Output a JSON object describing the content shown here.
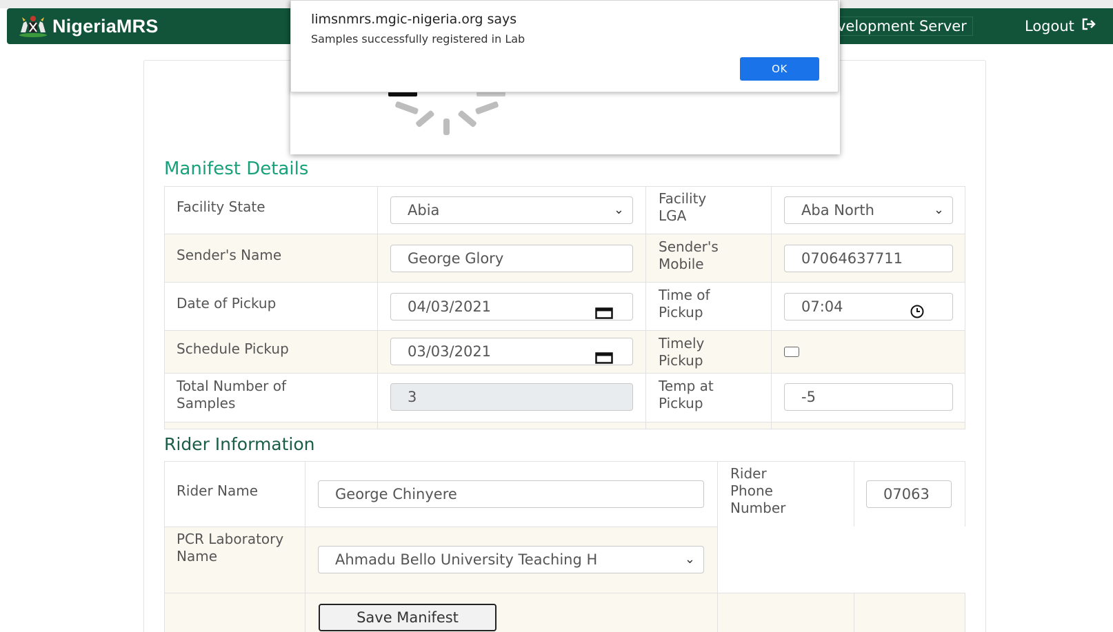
{
  "navbar": {
    "brand": "NigeriaMRS",
    "server_label": "velopment Server",
    "logout_label": "Logout",
    "logout_icon": "sign-out-icon",
    "background": "#12543a"
  },
  "manifest": {
    "title": "Manifest Details",
    "facility_state": {
      "label": "Facility State",
      "value": "Abia"
    },
    "facility_lga": {
      "label": "Facility LGA",
      "value": "Aba North"
    },
    "senders_name": {
      "label": "Sender's Name",
      "value": "George Glory"
    },
    "senders_mobile": {
      "label": "Sender's Mobile",
      "value": "07064637711"
    },
    "date_of_pickup": {
      "label": "Date of Pickup",
      "value": "04/03/2021"
    },
    "time_of_pickup": {
      "label": "Time of Pickup",
      "value": "07:04"
    },
    "schedule_pickup": {
      "label": "Schedule Pickup",
      "value": "03/03/2021"
    },
    "timely_pickup": {
      "label": "Timely Pickup",
      "checked": false
    },
    "total_samples": {
      "label": "Total Number of Samples",
      "value": "3"
    },
    "temp_at_pickup": {
      "label": "Temp at Pickup",
      "value": "-5"
    }
  },
  "rider": {
    "title": "Rider Information",
    "rider_name": {
      "label": "Rider Name",
      "value": "George Chinyere"
    },
    "rider_phone": {
      "label": "Rider Phone Number",
      "value": "07063"
    },
    "pcr_lab": {
      "label": "PCR Laboratory Name",
      "value": "Ahmadu Bello University Teaching H"
    },
    "save_label": "Save Manifest"
  },
  "alert": {
    "title": "limsnmrs.mgic-nigeria.org says",
    "message": "Samples successfully registered in Lab",
    "ok_label": "OK",
    "accent": "#1a73e8"
  },
  "colors": {
    "section_title": "#17a17a",
    "row_alt": "#fbf8ef"
  }
}
